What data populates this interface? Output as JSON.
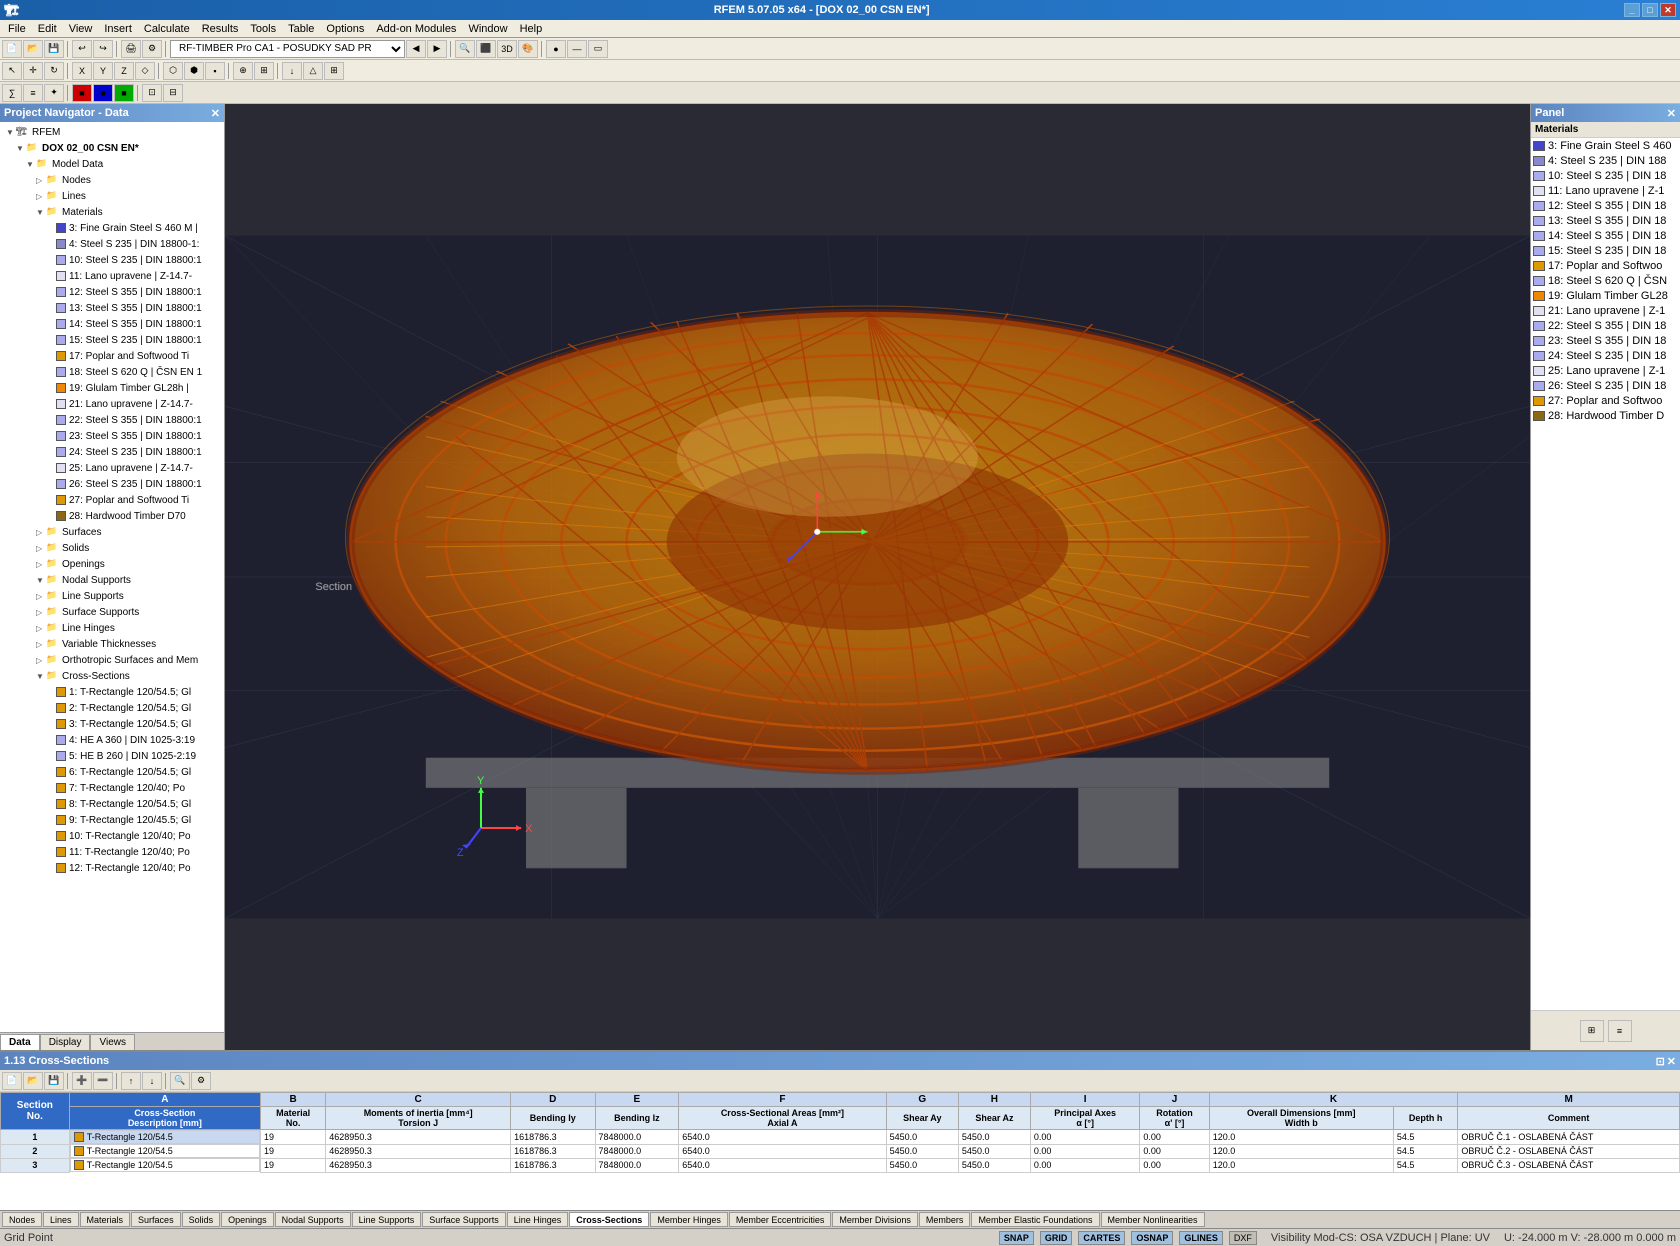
{
  "titlebar": {
    "title": "RFEM 5.07.05 x64 - [DOX 02_00 CSN EN*]",
    "controls": [
      "minimize",
      "maximize",
      "close"
    ]
  },
  "menubar": {
    "items": [
      "File",
      "Edit",
      "View",
      "Insert",
      "Calculate",
      "Results",
      "Tools",
      "Table",
      "Options",
      "Add-on Modules",
      "Window",
      "Help"
    ]
  },
  "toolbar1": {
    "dropdown_value": "RF-TIMBER Pro CA1 - POSUDKY SAD PR"
  },
  "left_panel": {
    "title": "Project Navigator - Data",
    "tabs": [
      "Data",
      "Display",
      "Views"
    ]
  },
  "tree": {
    "items": [
      {
        "id": "rfem",
        "label": "RFEM",
        "level": 0,
        "hasArrow": true,
        "expanded": true
      },
      {
        "id": "dox",
        "label": "DOX 02_00 CSN EN*",
        "level": 1,
        "hasArrow": true,
        "expanded": true,
        "bold": true
      },
      {
        "id": "model",
        "label": "Model Data",
        "level": 2,
        "hasArrow": true,
        "expanded": true
      },
      {
        "id": "nodes",
        "label": "Nodes",
        "level": 3,
        "hasArrow": false,
        "icon": "folder"
      },
      {
        "id": "lines",
        "label": "Lines",
        "level": 3,
        "hasArrow": false,
        "icon": "folder"
      },
      {
        "id": "materials",
        "label": "Materials",
        "level": 3,
        "hasArrow": true,
        "expanded": true,
        "icon": "folder"
      },
      {
        "id": "mat3",
        "label": "3: Fine Grain Steel S 460 M |",
        "level": 4,
        "colorBox": "#4444cc"
      },
      {
        "id": "mat4",
        "label": "4: Steel S 235 | DIN 18800-1:",
        "level": 4,
        "colorBox": "#8888cc"
      },
      {
        "id": "mat10",
        "label": "10: Steel S 235 | DIN 18800:1",
        "level": 4,
        "colorBox": "#aaaaee"
      },
      {
        "id": "mat11",
        "label": "11: Lano upravene | Z-14.7-",
        "level": 4,
        "colorBox": "#ccccee"
      },
      {
        "id": "mat12",
        "label": "12: Steel S 355 | DIN 18800:1",
        "level": 4,
        "colorBox": "#aaaaee"
      },
      {
        "id": "mat13",
        "label": "13: Steel S 355 | DIN 18800:1",
        "level": 4,
        "colorBox": "#aaaaee"
      },
      {
        "id": "mat14",
        "label": "14: Steel S 355 | DIN 18800:1",
        "level": 4,
        "colorBox": "#aaaaee"
      },
      {
        "id": "mat15",
        "label": "15: Steel S 235 | DIN 18800:1",
        "level": 4,
        "colorBox": "#aaaaee"
      },
      {
        "id": "mat17",
        "label": "17: Poplar and Softwood Ti",
        "level": 4,
        "colorBox": "#dd9900"
      },
      {
        "id": "mat18",
        "label": "18: Steel S 620 Q | ČSN EN 1",
        "level": 4,
        "colorBox": "#aaaaee"
      },
      {
        "id": "mat19",
        "label": "19: Glulam Timber GL28h |",
        "level": 4,
        "colorBox": "#dd9900"
      },
      {
        "id": "mat21",
        "label": "21: Lano upravene | Z-14.7-",
        "level": 4,
        "colorBox": "#ccccee"
      },
      {
        "id": "mat22",
        "label": "22: Steel S 355 | DIN 18800:1",
        "level": 4,
        "colorBox": "#aaaaee"
      },
      {
        "id": "mat23",
        "label": "23: Steel S 355 | DIN 18800:1",
        "level": 4,
        "colorBox": "#aaaaee"
      },
      {
        "id": "mat24",
        "label": "24: Steel S 235 | DIN 18800:1",
        "level": 4,
        "colorBox": "#aaaaee"
      },
      {
        "id": "mat25",
        "label": "25: Lano upravene | Z-14.7-",
        "level": 4,
        "colorBox": "#ccccee"
      },
      {
        "id": "mat26",
        "label": "26: Steel S 235 | DIN 18800:1",
        "level": 4,
        "colorBox": "#aaaaee"
      },
      {
        "id": "mat27",
        "label": "27: Poplar and Softwood Ti",
        "level": 4,
        "colorBox": "#dd9900"
      },
      {
        "id": "mat28",
        "label": "28: Hardwood Timber D70",
        "level": 4,
        "colorBox": "#8b6914"
      },
      {
        "id": "surfaces",
        "label": "Surfaces",
        "level": 3,
        "hasArrow": false,
        "icon": "folder"
      },
      {
        "id": "solids",
        "label": "Solids",
        "level": 3,
        "hasArrow": false,
        "icon": "folder"
      },
      {
        "id": "openings",
        "label": "Openings",
        "level": 3,
        "hasArrow": false,
        "icon": "folder"
      },
      {
        "id": "nodal_sup",
        "label": "Nodal Supports",
        "level": 3,
        "hasArrow": true,
        "icon": "folder"
      },
      {
        "id": "line_sup",
        "label": "Line Supports",
        "level": 3,
        "hasArrow": false,
        "icon": "folder"
      },
      {
        "id": "surface_sup",
        "label": "Surface Supports",
        "level": 3,
        "hasArrow": false,
        "icon": "folder"
      },
      {
        "id": "line_hinges",
        "label": "Line Hinges",
        "level": 3,
        "hasArrow": false,
        "icon": "folder"
      },
      {
        "id": "var_thick",
        "label": "Variable Thicknesses",
        "level": 3,
        "hasArrow": false,
        "icon": "folder"
      },
      {
        "id": "ortho",
        "label": "Orthotropic Surfaces and Mem",
        "level": 3,
        "hasArrow": false,
        "icon": "folder"
      },
      {
        "id": "cross_sec",
        "label": "Cross-Sections",
        "level": 3,
        "hasArrow": true,
        "expanded": true,
        "icon": "folder"
      },
      {
        "id": "cs1",
        "label": "1: T-Rectangle 120/54.5; Gl",
        "level": 4,
        "colorBox": "#dd9900"
      },
      {
        "id": "cs2",
        "label": "2: T-Rectangle 120/54.5; Gl",
        "level": 4,
        "colorBox": "#dd9900"
      },
      {
        "id": "cs3",
        "label": "3: T-Rectangle 120/54.5; Gl",
        "level": 4,
        "colorBox": "#dd9900"
      },
      {
        "id": "cs4",
        "label": "4: HE A 360 | DIN 1025-3:19",
        "level": 4,
        "colorBox": "#aaaaee"
      },
      {
        "id": "cs5",
        "label": "5: HE B 260 | DIN 1025-2:19",
        "level": 4,
        "colorBox": "#aaaaee"
      },
      {
        "id": "cs6",
        "label": "6: T-Rectangle 120/54.5; Gl",
        "level": 4,
        "colorBox": "#dd9900"
      },
      {
        "id": "cs7",
        "label": "7: T-Rectangle 120/40; Po",
        "level": 4,
        "colorBox": "#dd9900"
      },
      {
        "id": "cs8",
        "label": "8: T-Rectangle 120/54.5; Gl",
        "level": 4,
        "colorBox": "#dd9900"
      },
      {
        "id": "cs9",
        "label": "9: T-Rectangle 120/45.5; Gl",
        "level": 4,
        "colorBox": "#dd9900"
      },
      {
        "id": "cs10",
        "label": "10: T-Rectangle 120/40; Po",
        "level": 4,
        "colorBox": "#dd9900"
      },
      {
        "id": "cs11",
        "label": "11: T-Rectangle 120/40; Po",
        "level": 4,
        "colorBox": "#dd9900"
      },
      {
        "id": "cs12",
        "label": "12: T-Rectangle 120/40; Po",
        "level": 4,
        "colorBox": "#dd9900"
      }
    ]
  },
  "right_panel": {
    "title": "Panel",
    "materials_title": "Materials",
    "materials": [
      {
        "id": "3",
        "label": "3: Fine Grain Steel S 460",
        "color": "#4444cc"
      },
      {
        "id": "4",
        "label": "4: Steel S 235 | DIN 188",
        "color": "#8888cc"
      },
      {
        "id": "10",
        "label": "10: Steel S 235 | DIN 18",
        "color": "#aaaaee"
      },
      {
        "id": "11",
        "label": "11: Lano upravene | Z-1",
        "color": "#e0e0f0"
      },
      {
        "id": "12",
        "label": "12: Steel S 355 | DIN 18",
        "color": "#aaaaee"
      },
      {
        "id": "13",
        "label": "13: Steel S 355 | DIN 18",
        "color": "#aaaaee"
      },
      {
        "id": "14",
        "label": "14: Steel S 355 | DIN 18",
        "color": "#aaaaee"
      },
      {
        "id": "15",
        "label": "15: Steel S 235 | DIN 18",
        "color": "#aaaaee"
      },
      {
        "id": "17",
        "label": "17: Poplar and Softwoo",
        "color": "#dd9900"
      },
      {
        "id": "18",
        "label": "18: Steel S 620 Q | ČSN",
        "color": "#aaaaee"
      },
      {
        "id": "19",
        "label": "19: Glulam Timber GL28",
        "color": "#ee8800"
      },
      {
        "id": "21",
        "label": "21: Lano upravene | Z-1",
        "color": "#e0e0f0"
      },
      {
        "id": "22",
        "label": "22: Steel S 355 | DIN 18",
        "color": "#aaaaee"
      },
      {
        "id": "23",
        "label": "23: Steel S 355 | DIN 18",
        "color": "#aaaaee"
      },
      {
        "id": "24",
        "label": "24: Steel S 235 | DIN 18",
        "color": "#aaaaee"
      },
      {
        "id": "25",
        "label": "25: Lano upravene | Z-1",
        "color": "#e0e0f0"
      },
      {
        "id": "26",
        "label": "26: Steel S 235 | DIN 18",
        "color": "#aaaaee"
      },
      {
        "id": "27",
        "label": "27: Poplar and Softwoo",
        "color": "#dd9900"
      },
      {
        "id": "28",
        "label": "28: Hardwood Timber D",
        "color": "#8b6914"
      }
    ]
  },
  "bottom_section": {
    "title": "1.13 Cross-Sections",
    "table": {
      "col_headers": [
        "A",
        "B",
        "C",
        "D",
        "E",
        "F",
        "G",
        "H",
        "I",
        "J",
        "K",
        "M"
      ],
      "sub_headers": {
        "A": "Cross-Section\nDescription [mm]",
        "B": "Material\nNo.",
        "C": "Moments of inertia [mm⁴]\nTorsion J",
        "D": "Bending Iy",
        "E": "Bending Iz",
        "F": "Cross-Sectional Areas [mm²]\nAxial A",
        "G": "Shear Ay",
        "H": "Shear Az",
        "I": "Principal Axes\nα [°]",
        "J": "Rotation\nα' [°]",
        "K": "Overall Dimensions [mm]\nWidth b",
        "K2": "Depth h",
        "M": "Comment"
      },
      "section_col": "Section\nNo.",
      "rows": [
        {
          "no": 1,
          "desc": "T-Rectangle 120/54.5",
          "mat": 19,
          "J": "4628950.3",
          "Iy": "1618786.3",
          "Iz": "7848000.0",
          "A": "6540.0",
          "Ay": "5450.0",
          "Az": "5450.0",
          "alpha": "0.00",
          "alpha2": "0.00",
          "b": "120.0",
          "h": "54.5",
          "comment": "OBRUČ Č.1 - OSLABENÁ ČÁST",
          "color": "#dd9900"
        },
        {
          "no": 2,
          "desc": "T-Rectangle 120/54.5",
          "mat": 19,
          "J": "4628950.3",
          "Iy": "1618786.3",
          "Iz": "7848000.0",
          "A": "6540.0",
          "Ay": "5450.0",
          "Az": "5450.0",
          "alpha": "0.00",
          "alpha2": "0.00",
          "b": "120.0",
          "h": "54.5",
          "comment": "OBRUČ Č.2 - OSLABENÁ ČÁST",
          "color": "#dd9900"
        },
        {
          "no": 3,
          "desc": "T-Rectangle 120/54.5",
          "mat": 19,
          "J": "4628950.3",
          "Iy": "1618786.3",
          "Iz": "7848000.0",
          "A": "6540.0",
          "Ay": "5450.0",
          "Az": "5450.0",
          "alpha": "0.00",
          "alpha2": "0.00",
          "b": "120.0",
          "h": "54.5",
          "comment": "OBRUČ Č.3 - OSLABENÁ ČÁST",
          "color": "#dd9900"
        }
      ]
    }
  },
  "bottom_tabs": [
    "Nodes",
    "Lines",
    "Materials",
    "Surfaces",
    "Solids",
    "Openings",
    "Nodal Supports",
    "Line Supports",
    "Surface Supports",
    "Line Hinges",
    "Cross-Sections",
    "Member Hinges",
    "Member Eccentricities",
    "Member Divisions",
    "Members",
    "Member Elastic Foundations",
    "Member Nonlinearities"
  ],
  "active_bottom_tab": "Cross-Sections",
  "status_bar": {
    "left": "Grid Point",
    "buttons": [
      "SNAP",
      "GRID",
      "CARTES",
      "OSNAP",
      "GLINES",
      "DXF"
    ],
    "active_buttons": [
      "SNAP",
      "GRID",
      "CARTES",
      "OSNAP",
      "GLINES"
    ],
    "right_info": "Visibility Mod-CS: OSA VZDUCH | Plane: UV",
    "coords": "U: -24.000 m   V: -28.000 m   0.000 m"
  }
}
